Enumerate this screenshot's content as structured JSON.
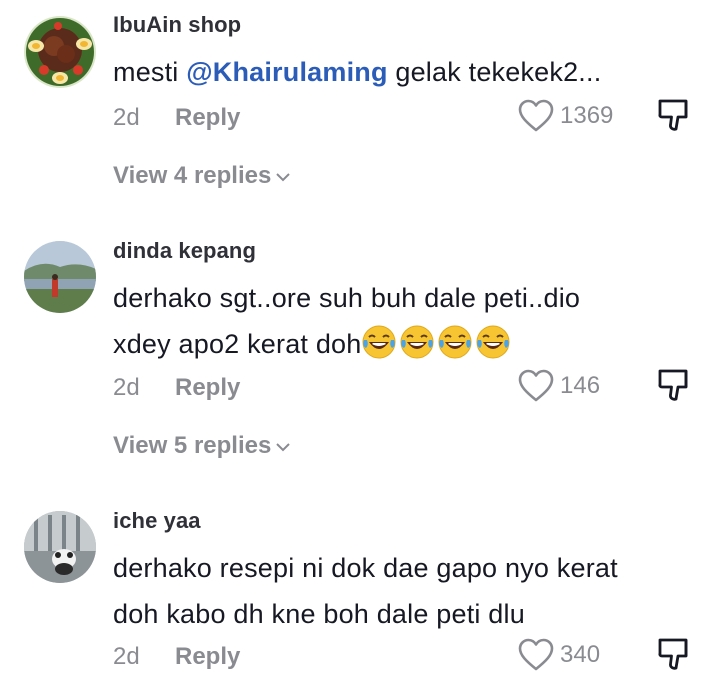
{
  "comments": [
    {
      "username": "IbuAin shop",
      "text_prefix": "mesti ",
      "mention": "@Khairulaming",
      "text_suffix": " gelak tekekek2...",
      "time": "2d",
      "reply_label": "Reply",
      "likes": "1369",
      "view_replies": "View 4 replies"
    },
    {
      "username": "dinda kepang",
      "text_line1": "derhako sgt..ore suh buh dale peti..dio",
      "text_line2": "xdey apo2 kerat doh",
      "emojis": [
        "face-with-tears-of-joy",
        "face-with-tears-of-joy",
        "face-with-tears-of-joy",
        "face-with-tears-of-joy"
      ],
      "time": "2d",
      "reply_label": "Reply",
      "likes": "146",
      "view_replies": "View 5 replies"
    },
    {
      "username": "iche yaa",
      "text_line1": "derhako resepi ni dok dae gapo nyo kerat",
      "text_line2": "doh kabo dh kne boh dale peti dlu",
      "time": "2d",
      "reply_label": "Reply",
      "likes": "340"
    }
  ],
  "colors": {
    "mention": "#2b5db8",
    "muted": "#8a8b91",
    "text": "#161823"
  }
}
